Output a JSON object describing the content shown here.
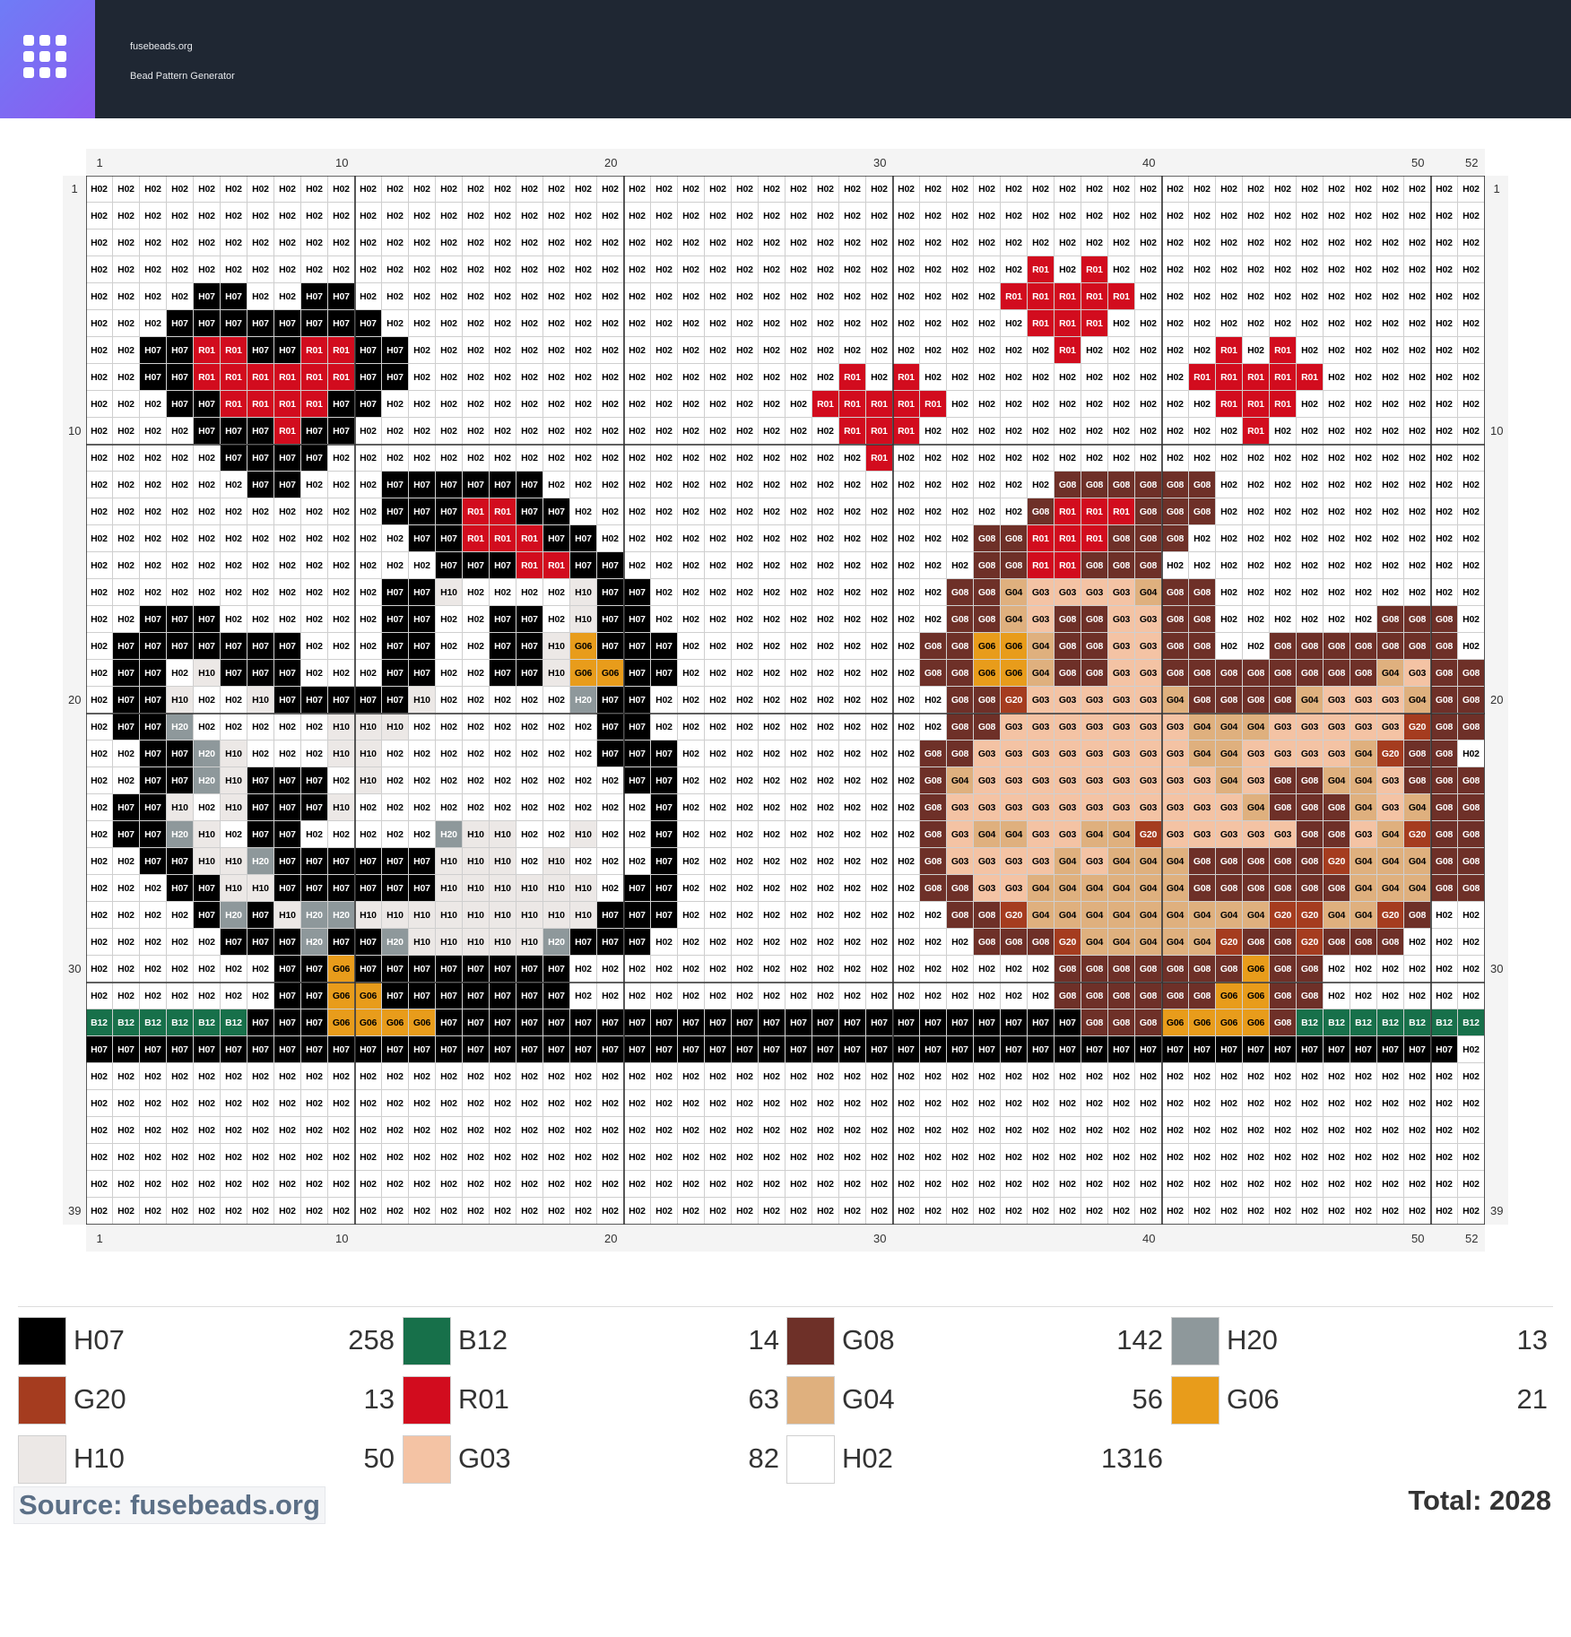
{
  "header": {
    "site_name": "fusebeads.org",
    "subtitle": "Bead Pattern Generator",
    "logo_icon": "grid-icon"
  },
  "pattern": {
    "columns": 52,
    "rows": 39,
    "column_labels": [
      "1",
      "10",
      "20",
      "30",
      "40",
      "50",
      "52"
    ],
    "row_labels": [
      "1",
      "10",
      "20",
      "30",
      "39"
    ],
    "grid_rows": [
      "H02 H02 H02 H02 H02 H02 H02 H02 H02 H02 H02 H02 H02 H02 H02 H02 H02 H02 H02 H02 H02 H02 H02 H02 H02 H02 H02 H02 H02 H02 H02 H02 H02 H02 H02 H02 H02 H02 H02 H02 H02 H02 H02 H02 H02 H02 H02 H02 H02 H02 H02 H02",
      "H02 H02 H02 H02 H02 H02 H02 H02 H02 H02 H02 H02 H02 H02 H02 H02 H02 H02 H02 H02 H02 H02 H02 H02 H02 H02 H02 H02 H02 H02 H02 H02 H02 H02 H02 H02 H02 H02 H02 H02 H02 H02 H02 H02 H02 H02 H02 H02 H02 H02 H02 H02",
      "H02 H02 H02 H02 H02 H02 H02 H02 H02 H02 H02 H02 H02 H02 H02 H02 H02 H02 H02 H02 H02 H02 H02 H02 H02 H02 H02 H02 H02 H02 H02 H02 H02 H02 H02 H02 H02 H02 H02 H02 H02 H02 H02 H02 H02 H02 H02 H02 H02 H02 H02 H02",
      "H02 H02 H02 H02 H02 H02 H02 H02 H02 H02 H02 H02 H02 H02 H02 H02 H02 H02 H02 H02 H02 H02 H02 H02 H02 H02 H02 H02 H02 H02 H02 H02 H02 H02 H02 R01 H02 R01 H02 H02 H02 H02 H02 H02 H02 H02 H02 H02 H02 H02 H02 H02",
      "H02 H02 H02 H02 H07 H07 H02 H02 H07 H07 H02 H02 H02 H02 H02 H02 H02 H02 H02 H02 H02 H02 H02 H02 H02 H02 H02 H02 H02 H02 H02 H02 H02 H02 R01 R01 R01 R01 R01 H02 H02 H02 H02 H02 H02 H02 H02 H02 H02 H02 H02 H02",
      "H02 H02 H02 H07 H07 H07 H07 H07 H07 H07 H07 H02 H02 H02 H02 H02 H02 H02 H02 H02 H02 H02 H02 H02 H02 H02 H02 H02 H02 H02 H02 H02 H02 H02 H02 R01 R01 R01 H02 H02 H02 H02 H02 H02 H02 H02 H02 H02 H02 H02 H02 H02",
      "H02 H02 H07 H07 R01 R01 H07 H07 R01 R01 H07 H07 H02 H02 H02 H02 H02 H02 H02 H02 H02 H02 H02 H02 H02 H02 H02 H02 H02 H02 H02 H02 H02 H02 H02 H02 R01 H02 H02 H02 H02 H02 R01 H02 R01 H02 H02 H02 H02 H02 H02 H02",
      "H02 H02 H07 H07 R01 R01 R01 R01 R01 R01 H07 H07 H02 H02 H02 H02 H02 H02 H02 H02 H02 H02 H02 H02 H02 H02 H02 H02 R01 H02 R01 H02 H02 H02 H02 H02 H02 H02 H02 H02 H02 R01 R01 R01 R01 R01 H02 H02 H02 H02 H02 H02",
      "H02 H02 H02 H07 H07 R01 R01 R01 R01 H07 H07 H02 H02 H02 H02 H02 H02 H02 H02 H02 H02 H02 H02 H02 H02 H02 H02 R01 R01 R01 R01 R01 H02 H02 H02 H02 H02 H02 H02 H02 H02 H02 R01 R01 R01 H02 H02 H02 H02 H02 H02 H02",
      "H02 H02 H02 H02 H07 H07 H07 R01 H07 H07 H02 H02 H02 H02 H02 H02 H02 H02 H02 H02 H02 H02 H02 H02 H02 H02 H02 H02 R01 R01 R01 H02 H02 H02 H02 H02 H02 H02 H02 H02 H02 H02 H02 R01 H02 H02 H02 H02 H02 H02 H02 H02",
      "H02 H02 H02 H02 H02 H07 H07 H07 H07 H02 H02 H02 H02 H02 H02 H02 H02 H02 H02 H02 H02 H02 H02 H02 H02 H02 H02 H02 H02 R01 H02 H02 H02 H02 H02 H02 H02 H02 H02 H02 H02 H02 H02 H02 H02 H02 H02 H02 H02 H02 H02 H02",
      "H02 H02 H02 H02 H02 H02 H07 H07 H02 H02 H02 H07 H07 H07 H07 H07 H07 H02 H02 H02 H02 H02 H02 H02 H02 H02 H02 H02 H02 H02 H02 H02 H02 H02 H02 H02 G08 G08 G08 G08 G08 G08 H02 H02 H02 H02 H02 H02 H02 H02 H02 H02",
      "H02 H02 H02 H02 H02 H02 H02 H02 H02 H02 H02 H07 H07 H07 R01 R01 H07 H07 H02 H02 H02 H02 H02 H02 H02 H02 H02 H02 H02 H02 H02 H02 H02 H02 H02 G08 R01 R01 R01 G08 G08 G08 H02 H02 H02 H02 H02 H02 H02 H02 H02 H02",
      "H02 H02 H02 H02 H02 H02 H02 H02 H02 H02 H02 H02 H07 H07 R01 R01 R01 H07 H07 H02 H02 H02 H02 H02 H02 H02 H02 H02 H02 H02 H02 H02 H02 G08 G08 R01 R01 R01 G08 G08 G08 H02 H02 H02 H02 H02 H02 H02 H02 H02 H02 H02",
      "H02 H02 H02 H02 H02 H02 H02 H02 H02 H02 H02 H02 H02 H07 H07 H07 R01 R01 H07 H07 H02 H02 H02 H02 H02 H02 H02 H02 H02 H02 H02 H02 H02 G08 G08 R01 R01 G08 G08 G08 H02 H02 H02 H02 H02 H02 H02 H02 H02 H02 H02 H02",
      "H02 H02 H02 H02 H02 H02 H02 H02 H02 H02 H02 H07 H07 H10 H02 H02 H02 H02 H10 H07 H07 H02 H02 H02 H02 H02 H02 H02 H02 H02 H02 H02 G08 G08 G04 G03 G03 G03 G03 G04 G08 G08 H02 H02 H02 H02 H02 H02 H02 H02 H02 H02",
      "H02 H02 H07 H07 H07 H02 H02 H02 H02 H02 H02 H07 H07 H02 H02 H07 H07 H02 H10 H07 H07 H02 H02 H02 H02 H02 H02 H02 H02 H02 H02 H02 G08 G08 G04 G03 G08 G08 G03 G03 G08 G08 H02 H02 H02 H02 H02 H02 G08 G08 G08 H02",
      "H02 H07 H07 H07 H07 H07 H07 H07 H02 H02 H02 H07 H07 H02 H02 H07 H07 H10 G06 H07 H07 H07 H02 H02 H02 H02 H02 H02 H02 H02 H02 G08 G08 G06 G06 G04 G08 G08 G03 G03 G08 G08 H02 H02 G08 G08 G08 G08 G08 G08 G08 H02",
      "H02 H07 H07 H02 H10 H07 H07 H07 H02 H02 H02 H07 H07 H02 H02 H07 H07 H10 G06 G06 H07 H07 H02 H02 H02 H02 H02 H02 H02 H02 H02 G08 G08 G06 G06 G04 G08 G08 G03 G03 G08 G08 G08 G08 G08 G08 G08 G08 G04 G03 G08 G08",
      "H02 H07 H07 H10 H02 H02 H10 H07 H07 H07 H07 H07 H10 H02 H02 H02 H02 H02 H20 H07 H07 H02 H02 H02 H02 H02 H02 H02 H02 H02 H02 H02 G08 G08 G20 G03 G03 G03 G03 G03 G04 G08 G08 G08 G08 G04 G03 G03 G03 G04 G08 G08",
      "H02 H07 H07 H20 H02 H02 H02 H02 H02 H10 H10 H10 H02 H02 H02 H02 H02 H02 H02 H07 H07 H02 H02 H02 H02 H02 H02 H02 H02 H02 H02 H02 G08 G08 G03 G03 G03 G03 G03 G03 G03 G04 G04 G04 G03 G03 G03 G03 G03 G20 G08 G08",
      "H02 H02 H07 H07 H20 H10 H02 H02 H02 H10 H10 H02 H02 H02 H02 H02 H02 H02 H02 H07 H07 H07 H02 H02 H02 H02 H02 H02 H02 H02 H02 G08 G08 G03 G03 G03 G03 G03 G03 G03 G03 G04 G04 G03 G03 G03 G03 G04 G20 G08 G08 H02",
      "H02 H02 H07 H07 H20 H10 H07 H07 H07 H02 H10 H02 H02 H02 H02 H02 H02 H02 H02 H02 H07 H07 H02 H02 H02 H02 H02 H02 H02 H02 H02 G08 G04 G03 G03 G03 G03 G03 G03 G03 G03 G03 G04 G03 G08 G08 G04 G04 G03 G08 G08 G08",
      "H02 H07 H07 H10 H02 H10 H07 H07 H07 H10 H02 H02 H02 H02 H02 H02 H02 H02 H02 H02 H02 H07 H02 H02 H02 H02 H02 H02 H02 H02 H02 G08 G03 G03 G03 G03 G03 G03 G03 G03 G03 G03 G03 G04 G08 G08 G08 G04 G03 G04 G08 G08",
      "H02 H07 H07 H20 H10 H02 H07 H07 H02 H02 H02 H02 H02 H20 H10 H10 H02 H02 H10 H02 H02 H07 H02 H02 H02 H02 H02 H02 H02 H02 H02 G08 G03 G04 G04 G03 G03 G04 G04 G20 G03 G03 G03 G03 G03 G08 G08 G03 G04 G20 G08 G08",
      "H02 H02 H07 H07 H10 H10 H20 H07 H07 H07 H07 H07 H07 H10 H10 H10 H02 H10 H02 H02 H02 H07 H02 H02 H02 H02 H02 H02 H02 H02 H02 G08 G03 G03 G03 G03 G04 G03 G04 G04 G04 G08 G08 G08 G08 G08 G20 G04 G04 G04 G08 G08",
      "H02 H02 H02 H07 H07 H10 H10 H07 H07 H07 H07 H07 H07 H10 H10 H10 H10 H10 H10 H02 H07 H07 H02 H02 H02 H02 H02 H02 H02 H02 H02 G08 G08 G03 G03 G04 G04 G04 G04 G04 G04 G08 G08 G08 G08 G08 G08 G04 G04 G04 G08 G08",
      "H02 H02 H02 H02 H07 H20 H07 H10 H20 H20 H10 H10 H10 H10 H10 H10 H10 H10 H10 H07 H07 H07 H02 H02 H02 H02 H02 H02 H02 H02 H02 H02 G08 G08 G20 G04 G04 G04 G04 G04 G04 G04 G04 G04 G20 G20 G04 G04 G20 G08 H02 H02",
      "H02 H02 H02 H02 H02 H07 H07 H07 H20 H07 H07 H20 H10 H10 H10 H10 H10 H20 H07 H07 H07 H02 H02 H02 H02 H02 H02 H02 H02 H02 H02 H02 H02 G08 G08 G08 G20 G04 G04 G04 G04 G04 G20 G08 G08 G20 G08 G08 G08 H02 H02 H02",
      "H02 H02 H02 H02 H02 H02 H02 H07 H07 G06 H07 H07 H07 H07 H07 H07 H07 H07 H02 H02 H02 H02 H02 H02 H02 H02 H02 H02 H02 H02 H02 H02 H02 H02 H02 H02 G08 G08 G08 G08 G08 G08 G08 G06 G08 G08 H02 H02 H02 H02 H02 H02",
      "H02 H02 H02 H02 H02 H02 H02 H07 H07 G06 G06 H07 H07 H07 H07 H07 H07 H07 H02 H02 H02 H02 H02 H02 H02 H02 H02 H02 H02 H02 H02 H02 H02 H02 H02 H02 G08 G08 G08 G08 G08 G08 G06 G06 G08 G08 H02 H02 H02 H02 H02 H02",
      "B12 B12 B12 B12 B12 B12 H07 H07 H07 G06 G06 G06 G06 H07 H07 H07 H07 H07 H07 H07 H07 H07 H07 H07 H07 H07 H07 H07 H07 H07 H07 H07 H07 H07 H07 H07 H07 G08 G08 G08 G06 G06 G06 G06 G08 B12 B12 B12 B12 B12 B12 B12",
      "H07 H07 H07 H07 H07 H07 H07 H07 H07 H07 H07 H07 H07 H07 H07 H07 H07 H07 H07 H07 H07 H07 H07 H07 H07 H07 H07 H07 H07 H07 H07 H07 H07 H07 H07 H07 H07 H07 H07 H07 H07 H07 H07 H07 H07 H07 H07 H07 H07 H07 H07 H02",
      "H02 H02 H02 H02 H02 H02 H02 H02 H02 H02 H02 H02 H02 H02 H02 H02 H02 H02 H02 H02 H02 H02 H02 H02 H02 H02 H02 H02 H02 H02 H02 H02 H02 H02 H02 H02 H02 H02 H02 H02 H02 H02 H02 H02 H02 H02 H02 H02 H02 H02 H02 H02",
      "H02 H02 H02 H02 H02 H02 H02 H02 H02 H02 H02 H02 H02 H02 H02 H02 H02 H02 H02 H02 H02 H02 H02 H02 H02 H02 H02 H02 H02 H02 H02 H02 H02 H02 H02 H02 H02 H02 H02 H02 H02 H02 H02 H02 H02 H02 H02 H02 H02 H02 H02 H02",
      "H02 H02 H02 H02 H02 H02 H02 H02 H02 H02 H02 H02 H02 H02 H02 H02 H02 H02 H02 H02 H02 H02 H02 H02 H02 H02 H02 H02 H02 H02 H02 H02 H02 H02 H02 H02 H02 H02 H02 H02 H02 H02 H02 H02 H02 H02 H02 H02 H02 H02 H02 H02",
      "H02 H02 H02 H02 H02 H02 H02 H02 H02 H02 H02 H02 H02 H02 H02 H02 H02 H02 H02 H02 H02 H02 H02 H02 H02 H02 H02 H02 H02 H02 H02 H02 H02 H02 H02 H02 H02 H02 H02 H02 H02 H02 H02 H02 H02 H02 H02 H02 H02 H02 H02 H02",
      "H02 H02 H02 H02 H02 H02 H02 H02 H02 H02 H02 H02 H02 H02 H02 H02 H02 H02 H02 H02 H02 H02 H02 H02 H02 H02 H02 H02 H02 H02 H02 H02 H02 H02 H02 H02 H02 H02 H02 H02 H02 H02 H02 H02 H02 H02 H02 H02 H02 H02 H02 H02",
      "H02 H02 H02 H02 H02 H02 H02 H02 H02 H02 H02 H02 H02 H02 H02 H02 H02 H02 H02 H02 H02 H02 H02 H02 H02 H02 H02 H02 H02 H02 H02 H02 H02 H02 H02 H02 H02 H02 H02 H02 H02 H02 H02 H02 H02 H02 H02 H02 H02 H02 H02 H02"
    ]
  },
  "colors": {
    "H07": {
      "bg": "#000000",
      "fg": "#ffffff"
    },
    "B12": {
      "bg": "#17704a",
      "fg": "#ffffff"
    },
    "G08": {
      "bg": "#6e3028",
      "fg": "#ffffff"
    },
    "H20": {
      "bg": "#8e989b",
      "fg": "#ffffff"
    },
    "G20": {
      "bg": "#a53c1f",
      "fg": "#ffffff"
    },
    "R01": {
      "bg": "#d20c1e",
      "fg": "#ffffff"
    },
    "G04": {
      "bg": "#dfb07e",
      "fg": "#000000"
    },
    "G06": {
      "bg": "#e89c1b",
      "fg": "#000000"
    },
    "H10": {
      "bg": "#ece8e6",
      "fg": "#000000"
    },
    "G03": {
      "bg": "#f4c3a4",
      "fg": "#000000"
    },
    "H02": {
      "bg": "#ffffff",
      "fg": "#000000"
    }
  },
  "legend": [
    {
      "code": "H07",
      "count": "258",
      "color": "#000000"
    },
    {
      "code": "B12",
      "count": "14",
      "color": "#17704a"
    },
    {
      "code": "G08",
      "count": "142",
      "color": "#6e3028"
    },
    {
      "code": "H20",
      "count": "13",
      "color": "#8e989b"
    },
    {
      "code": "G20",
      "count": "13",
      "color": "#a53c1f"
    },
    {
      "code": "R01",
      "count": "63",
      "color": "#d20c1e"
    },
    {
      "code": "G04",
      "count": "56",
      "color": "#dfb07e"
    },
    {
      "code": "G06",
      "count": "21",
      "color": "#e89c1b"
    },
    {
      "code": "H10",
      "count": "50",
      "color": "#ece8e6"
    },
    {
      "code": "G03",
      "count": "82",
      "color": "#f4c3a4"
    },
    {
      "code": "H02",
      "count": "1316",
      "color": "#ffffff"
    }
  ],
  "footer": {
    "source": "Source: fusebeads.org",
    "total": "Total: 2028"
  }
}
